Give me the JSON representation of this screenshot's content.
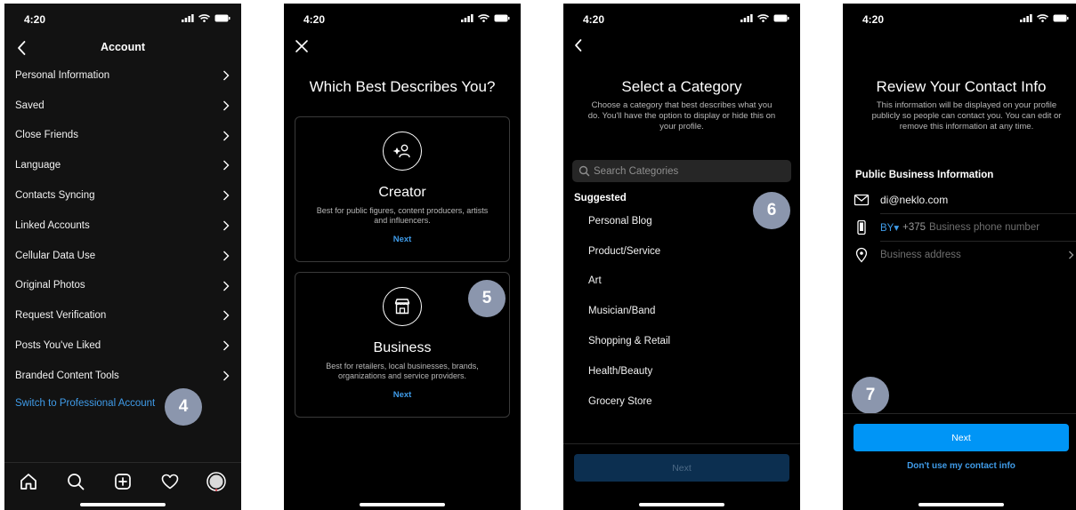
{
  "status": {
    "time": "4:20"
  },
  "colors": {
    "accent": "#0095f6",
    "link": "#3f9be8",
    "badge": "#8b96ad",
    "background": "#000000"
  },
  "screen1": {
    "title": "Account",
    "items": [
      {
        "label": "Personal Information"
      },
      {
        "label": "Saved"
      },
      {
        "label": "Close Friends"
      },
      {
        "label": "Language"
      },
      {
        "label": "Contacts Syncing"
      },
      {
        "label": "Linked Accounts"
      },
      {
        "label": "Cellular Data Use"
      },
      {
        "label": "Original Photos"
      },
      {
        "label": "Request Verification"
      },
      {
        "label": "Posts You've Liked"
      },
      {
        "label": "Branded Content Tools"
      }
    ],
    "switch_link": "Switch to Professional Account",
    "badge": "4",
    "tabs": [
      "home-icon",
      "search-icon",
      "add-post-icon",
      "activity-heart-icon",
      "profile-avatar"
    ]
  },
  "screen2": {
    "title": "Which Best Describes You?",
    "creator": {
      "title": "Creator",
      "desc": "Best for public figures, content producers, artists and influencers.",
      "next": "Next"
    },
    "business": {
      "title": "Business",
      "desc": "Best for retailers, local businesses, brands, organizations and service providers.",
      "next": "Next"
    },
    "badge": "5"
  },
  "screen3": {
    "title": "Select a Category",
    "desc": "Choose a category that best describes what you do. You'll have the option to display or hide this on your profile.",
    "search_placeholder": "Search Categories",
    "suggested_label": "Suggested",
    "categories": [
      {
        "label": "Personal Blog"
      },
      {
        "label": "Product/Service"
      },
      {
        "label": "Art"
      },
      {
        "label": "Musician/Band"
      },
      {
        "label": "Shopping & Retail"
      },
      {
        "label": "Health/Beauty"
      },
      {
        "label": "Grocery Store"
      }
    ],
    "next": "Next",
    "badge": "6"
  },
  "screen4": {
    "title": "Review Your Contact Info",
    "desc": "This information will be displayed on your profile publicly so people can contact you. You can edit or remove this information at any time.",
    "section_label": "Public Business Information",
    "email": "di@neklo.com",
    "country_code": "BY",
    "dial_code": "+375",
    "phone_placeholder": "Business phone number",
    "address_placeholder": "Business address",
    "next": "Next",
    "skip": "Don't use my contact info",
    "badge": "7"
  }
}
